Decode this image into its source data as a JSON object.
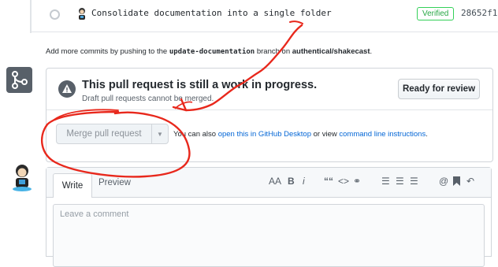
{
  "commit": {
    "message": "Consolidate documentation into a single folder",
    "verified": "Verified",
    "sha": "28652f1"
  },
  "info": {
    "prefix": "Add more commits by pushing to the ",
    "branch": "update-documentation",
    "middle": " branch on ",
    "repo": "authentical/shakecast",
    "suffix": "."
  },
  "merge": {
    "title": "This pull request is still a work in progress.",
    "subtitle": "Draft pull requests cannot be merged.",
    "ready_label": "Ready for review",
    "merge_label": "Merge pull request",
    "alt_prefix": "You can also ",
    "alt_link1": "open this in GitHub Desktop",
    "alt_middle": " or view ",
    "alt_link2": "command line instructions",
    "alt_suffix": "."
  },
  "editor": {
    "tab_write": "Write",
    "tab_preview": "Preview",
    "placeholder": "Leave a comment",
    "tools": {
      "heading": "AA",
      "bold": "B",
      "italic": "i",
      "quote": "““",
      "code": "<>",
      "link": "⚭",
      "bullet_list": "☰",
      "numbered_list": "☰",
      "task_list": "☰",
      "mention": "@",
      "reply": "↶"
    }
  },
  "colors": {
    "accent_link": "#0366d6",
    "verified": "#28a745",
    "annotation": "#e8281c"
  }
}
